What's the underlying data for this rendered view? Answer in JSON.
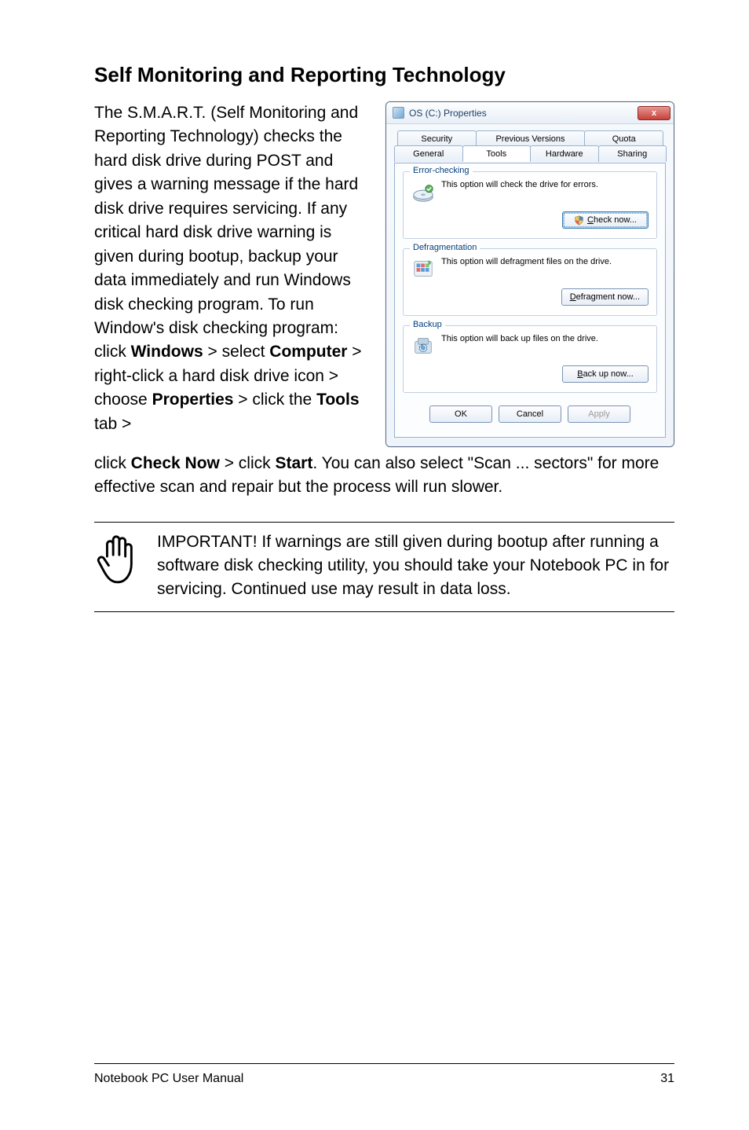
{
  "heading": "Self Monitoring and Reporting Technology",
  "para_left_html": "The S.M.A.R.T. (Self Monitoring and Reporting Technology) checks the hard disk drive during POST and gives a warning message if the hard disk drive requires servicing. If any critical hard disk drive warning is given during bootup, backup your data immediately and run Windows disk checking program. To run Window's disk checking program: click <b>Windows</b> > select <b>Computer</b> > right-click a hard disk drive icon > choose <b>Properties</b> > click the <b>Tools</b> tab >",
  "para_after_html": "click <b>Check Now</b> > click <b>Start</b>. You can also select \"Scan ... sectors\" for more effective scan and repair but the process will run slower.",
  "note_text": "IMPORTANT! If warnings are still given during bootup after running a software disk checking utility, you should take your Notebook PC in for servicing. Continued use may result in data loss.",
  "dialog": {
    "title": "OS (C:) Properties",
    "close_x": "x",
    "tabs_back": [
      "Security",
      "Previous Versions",
      "Quota"
    ],
    "tabs_front": [
      "General",
      "Tools",
      "Hardware",
      "Sharing"
    ],
    "active_tab": "Tools",
    "groups": {
      "error": {
        "title": "Error-checking",
        "text": "This option will check the drive for errors.",
        "button": "Check now...",
        "accel_prefix": "C"
      },
      "defrag": {
        "title": "Defragmentation",
        "text": "This option will defragment files on the drive.",
        "button": "Defragment now...",
        "accel_prefix": "D"
      },
      "backup": {
        "title": "Backup",
        "text": "This option will back up files on the drive.",
        "button": "Back up now...",
        "accel_prefix": "B"
      }
    },
    "footer": {
      "ok": "OK",
      "cancel": "Cancel",
      "apply": "Apply"
    }
  },
  "footer": {
    "left": "Notebook PC User Manual",
    "right": "31"
  }
}
